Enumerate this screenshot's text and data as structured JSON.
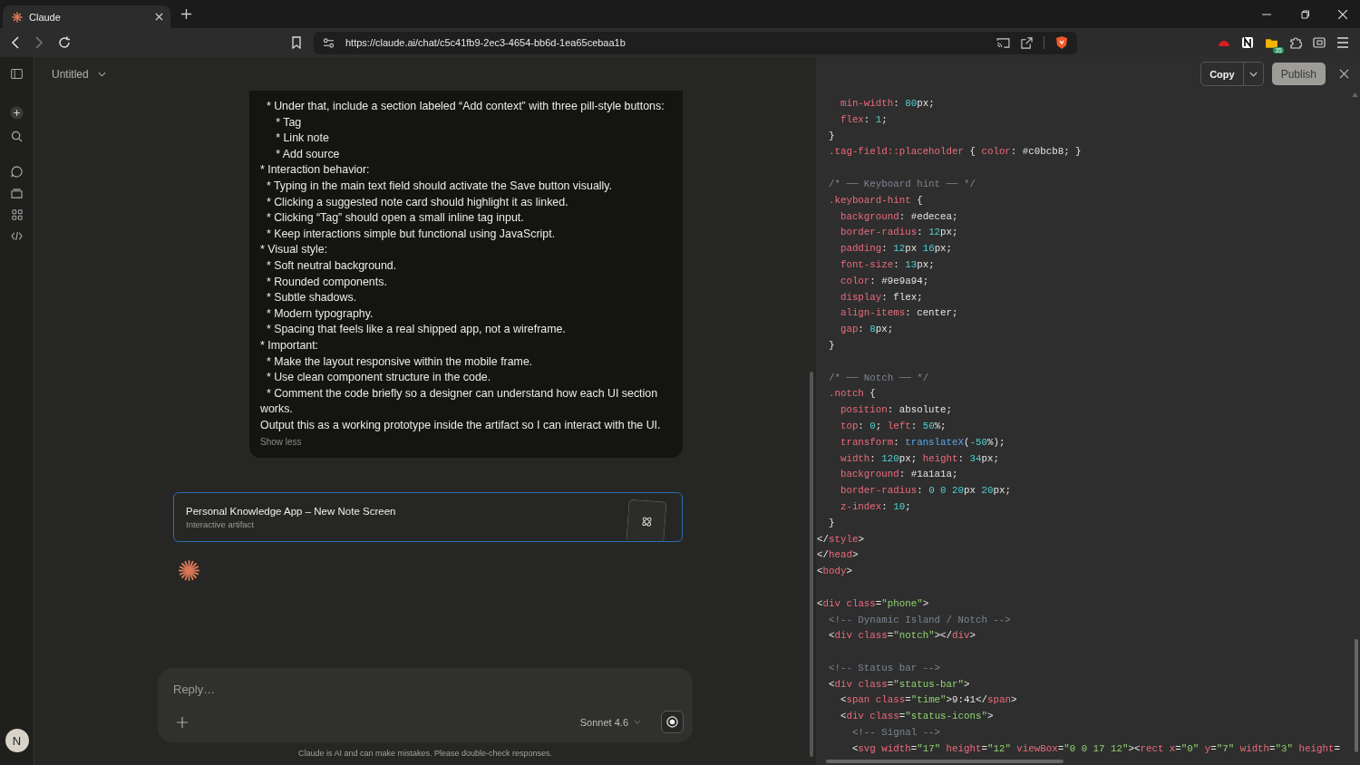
{
  "browser": {
    "tab": {
      "title": "Claude",
      "selected": true
    },
    "url": "https://claude.ai/chat/c5c41fb9-2ec3-4654-bb6d-1ea65cebaa1b",
    "extension_badge": "35"
  },
  "header": {
    "title": "Untitled"
  },
  "prompt": {
    "lines": [
      "  * Under that, include a section labeled “Add context” with three pill-style buttons:",
      "     * Tag",
      "     * Link note",
      "     * Add source",
      "* Interaction behavior:",
      "  * Typing in the main text field should activate the Save button visually.",
      "  * Clicking a suggested note card should highlight it as linked.",
      "  * Clicking “Tag” should open a small inline tag input.",
      "  * Keep interactions simple but functional using JavaScript.",
      "* Visual style:",
      "  * Soft neutral background.",
      "  * Rounded components.",
      "  * Subtle shadows.",
      "  * Modern typography.",
      "  * Spacing that feels like a real shipped app, not a wireframe.",
      "* Important:",
      "  * Make the layout responsive within the mobile frame.",
      "  * Use clean component structure in the code.",
      "  * Comment the code briefly so a designer can understand how each UI section works.",
      "Output this as a working prototype inside the artifact so I can interact with the UI."
    ],
    "toggle": "Show less"
  },
  "artifact": {
    "title": "Personal Knowledge App – New Note Screen",
    "subtitle": "Interactive artifact"
  },
  "composer": {
    "placeholder": "Reply…",
    "model": "Sonnet 4.6"
  },
  "disclaimer": "Claude is AI and can make mistakes. Please double-check responses.",
  "user": {
    "initial": "N"
  },
  "panel": {
    "copy": "Copy",
    "publish": "Publish"
  },
  "code": [
    {
      "kind": "code",
      "tokens": [
        {
          "kind": "property",
          "text": "    min-width"
        },
        {
          "kind": "plain",
          "text": ": "
        },
        {
          "kind": "number",
          "text": "80"
        },
        {
          "kind": "plain",
          "text": "px;"
        }
      ]
    },
    {
      "kind": "code",
      "tokens": [
        {
          "kind": "property",
          "text": "    flex"
        },
        {
          "kind": "plain",
          "text": ": "
        },
        {
          "kind": "number",
          "text": "1"
        },
        {
          "kind": "plain",
          "text": ";"
        }
      ]
    },
    {
      "kind": "code",
      "tokens": [
        {
          "kind": "plain",
          "text": "  }"
        }
      ]
    },
    {
      "kind": "code",
      "tokens": [
        {
          "kind": "selector",
          "text": "  .tag-field::placeholder"
        },
        {
          "kind": "plain",
          "text": " { "
        },
        {
          "kind": "property",
          "text": "color"
        },
        {
          "kind": "plain",
          "text": ": #c0bcb8; }"
        }
      ]
    },
    {
      "kind": "blank"
    },
    {
      "kind": "code",
      "tokens": [
        {
          "kind": "comment",
          "text": "  /* ── Keyboard hint ── */"
        }
      ]
    },
    {
      "kind": "code",
      "tokens": [
        {
          "kind": "selector",
          "text": "  .keyboard-hint"
        },
        {
          "kind": "plain",
          "text": " {"
        }
      ]
    },
    {
      "kind": "code",
      "tokens": [
        {
          "kind": "property",
          "text": "    background"
        },
        {
          "kind": "plain",
          "text": ": #edecea;"
        }
      ]
    },
    {
      "kind": "code",
      "tokens": [
        {
          "kind": "property",
          "text": "    border-radius"
        },
        {
          "kind": "plain",
          "text": ": "
        },
        {
          "kind": "number",
          "text": "12"
        },
        {
          "kind": "plain",
          "text": "px;"
        }
      ]
    },
    {
      "kind": "code",
      "tokens": [
        {
          "kind": "property",
          "text": "    padding"
        },
        {
          "kind": "plain",
          "text": ": "
        },
        {
          "kind": "number",
          "text": "12"
        },
        {
          "kind": "plain",
          "text": "px "
        },
        {
          "kind": "number",
          "text": "16"
        },
        {
          "kind": "plain",
          "text": "px;"
        }
      ]
    },
    {
      "kind": "code",
      "tokens": [
        {
          "kind": "property",
          "text": "    font-size"
        },
        {
          "kind": "plain",
          "text": ": "
        },
        {
          "kind": "number",
          "text": "13"
        },
        {
          "kind": "plain",
          "text": "px;"
        }
      ]
    },
    {
      "kind": "code",
      "tokens": [
        {
          "kind": "property",
          "text": "    color"
        },
        {
          "kind": "plain",
          "text": ": #9e9a94;"
        }
      ]
    },
    {
      "kind": "code",
      "tokens": [
        {
          "kind": "property",
          "text": "    display"
        },
        {
          "kind": "plain",
          "text": ": flex;"
        }
      ]
    },
    {
      "kind": "code",
      "tokens": [
        {
          "kind": "property",
          "text": "    align-items"
        },
        {
          "kind": "plain",
          "text": ": center;"
        }
      ]
    },
    {
      "kind": "code",
      "tokens": [
        {
          "kind": "property",
          "text": "    gap"
        },
        {
          "kind": "plain",
          "text": ": "
        },
        {
          "kind": "number",
          "text": "8"
        },
        {
          "kind": "plain",
          "text": "px;"
        }
      ]
    },
    {
      "kind": "code",
      "tokens": [
        {
          "kind": "plain",
          "text": "  }"
        }
      ]
    },
    {
      "kind": "blank"
    },
    {
      "kind": "code",
      "tokens": [
        {
          "kind": "comment",
          "text": "  /* ── Notch ── */"
        }
      ]
    },
    {
      "kind": "code",
      "tokens": [
        {
          "kind": "selector",
          "text": "  .notch"
        },
        {
          "kind": "plain",
          "text": " {"
        }
      ]
    },
    {
      "kind": "code",
      "tokens": [
        {
          "kind": "property",
          "text": "    position"
        },
        {
          "kind": "plain",
          "text": ": absolute;"
        }
      ]
    },
    {
      "kind": "code",
      "tokens": [
        {
          "kind": "property",
          "text": "    top"
        },
        {
          "kind": "plain",
          "text": ": "
        },
        {
          "kind": "number",
          "text": "0"
        },
        {
          "kind": "plain",
          "text": "; "
        },
        {
          "kind": "property",
          "text": "left"
        },
        {
          "kind": "plain",
          "text": ": "
        },
        {
          "kind": "number",
          "text": "50"
        },
        {
          "kind": "plain",
          "text": "%;"
        }
      ]
    },
    {
      "kind": "code",
      "tokens": [
        {
          "kind": "property",
          "text": "    transform"
        },
        {
          "kind": "plain",
          "text": ": "
        },
        {
          "kind": "function",
          "text": "translateX"
        },
        {
          "kind": "plain",
          "text": "("
        },
        {
          "kind": "number",
          "text": "-50"
        },
        {
          "kind": "plain",
          "text": "%);"
        }
      ]
    },
    {
      "kind": "code",
      "tokens": [
        {
          "kind": "property",
          "text": "    width"
        },
        {
          "kind": "plain",
          "text": ": "
        },
        {
          "kind": "number",
          "text": "120"
        },
        {
          "kind": "plain",
          "text": "px; "
        },
        {
          "kind": "property",
          "text": "height"
        },
        {
          "kind": "plain",
          "text": ": "
        },
        {
          "kind": "number",
          "text": "34"
        },
        {
          "kind": "plain",
          "text": "px;"
        }
      ]
    },
    {
      "kind": "code",
      "tokens": [
        {
          "kind": "property",
          "text": "    background"
        },
        {
          "kind": "plain",
          "text": ": #1a1a1a;"
        }
      ]
    },
    {
      "kind": "code",
      "tokens": [
        {
          "kind": "property",
          "text": "    border-radius"
        },
        {
          "kind": "plain",
          "text": ": "
        },
        {
          "kind": "number",
          "text": "0 0 20"
        },
        {
          "kind": "plain",
          "text": "px "
        },
        {
          "kind": "number",
          "text": "20"
        },
        {
          "kind": "plain",
          "text": "px;"
        }
      ]
    },
    {
      "kind": "code",
      "tokens": [
        {
          "kind": "property",
          "text": "    z-index"
        },
        {
          "kind": "plain",
          "text": ": "
        },
        {
          "kind": "number",
          "text": "10"
        },
        {
          "kind": "plain",
          "text": ";"
        }
      ]
    },
    {
      "kind": "code",
      "tokens": [
        {
          "kind": "plain",
          "text": "  }"
        }
      ]
    },
    {
      "kind": "code",
      "tokens": [
        {
          "kind": "plain",
          "text": "</"
        },
        {
          "kind": "tag",
          "text": "style"
        },
        {
          "kind": "plain",
          "text": ">"
        }
      ]
    },
    {
      "kind": "code",
      "tokens": [
        {
          "kind": "plain",
          "text": "</"
        },
        {
          "kind": "tag",
          "text": "head"
        },
        {
          "kind": "plain",
          "text": ">"
        }
      ]
    },
    {
      "kind": "code",
      "tokens": [
        {
          "kind": "plain",
          "text": "<"
        },
        {
          "kind": "tag",
          "text": "body"
        },
        {
          "kind": "plain",
          "text": ">"
        }
      ]
    },
    {
      "kind": "blank"
    },
    {
      "kind": "code",
      "tokens": [
        {
          "kind": "plain",
          "text": "<"
        },
        {
          "kind": "tag",
          "text": "div"
        },
        {
          "kind": "attr",
          "text": " class"
        },
        {
          "kind": "plain",
          "text": "="
        },
        {
          "kind": "string",
          "text": "\"phone\""
        },
        {
          "kind": "plain",
          "text": ">"
        }
      ]
    },
    {
      "kind": "code",
      "tokens": [
        {
          "kind": "comment",
          "text": "  <!-- Dynamic Island / Notch -->"
        }
      ]
    },
    {
      "kind": "code",
      "tokens": [
        {
          "kind": "plain",
          "text": "  <"
        },
        {
          "kind": "tag",
          "text": "div"
        },
        {
          "kind": "attr",
          "text": " class"
        },
        {
          "kind": "plain",
          "text": "="
        },
        {
          "kind": "string",
          "text": "\"notch\""
        },
        {
          "kind": "plain",
          "text": "></"
        },
        {
          "kind": "tag",
          "text": "div"
        },
        {
          "kind": "plain",
          "text": ">"
        }
      ]
    },
    {
      "kind": "blank"
    },
    {
      "kind": "code",
      "tokens": [
        {
          "kind": "comment",
          "text": "  <!-- Status bar -->"
        }
      ]
    },
    {
      "kind": "code",
      "tokens": [
        {
          "kind": "plain",
          "text": "  <"
        },
        {
          "kind": "tag",
          "text": "div"
        },
        {
          "kind": "attr",
          "text": " class"
        },
        {
          "kind": "plain",
          "text": "="
        },
        {
          "kind": "string",
          "text": "\"status-bar\""
        },
        {
          "kind": "plain",
          "text": ">"
        }
      ]
    },
    {
      "kind": "code",
      "tokens": [
        {
          "kind": "plain",
          "text": "    <"
        },
        {
          "kind": "tag",
          "text": "span"
        },
        {
          "kind": "attr",
          "text": " class"
        },
        {
          "kind": "plain",
          "text": "="
        },
        {
          "kind": "string",
          "text": "\"time\""
        },
        {
          "kind": "plain",
          "text": ">9:41</"
        },
        {
          "kind": "tag",
          "text": "span"
        },
        {
          "kind": "plain",
          "text": ">"
        }
      ]
    },
    {
      "kind": "code",
      "tokens": [
        {
          "kind": "plain",
          "text": "    <"
        },
        {
          "kind": "tag",
          "text": "div"
        },
        {
          "kind": "attr",
          "text": " class"
        },
        {
          "kind": "plain",
          "text": "="
        },
        {
          "kind": "string",
          "text": "\"status-icons\""
        },
        {
          "kind": "plain",
          "text": ">"
        }
      ]
    },
    {
      "kind": "code",
      "tokens": [
        {
          "kind": "comment",
          "text": "      <!-- Signal -->"
        }
      ]
    },
    {
      "kind": "code",
      "tokens": [
        {
          "kind": "plain",
          "text": "      <"
        },
        {
          "kind": "tag",
          "text": "svg"
        },
        {
          "kind": "attr",
          "text": " width"
        },
        {
          "kind": "plain",
          "text": "="
        },
        {
          "kind": "string",
          "text": "\"17\""
        },
        {
          "kind": "attr",
          "text": " height"
        },
        {
          "kind": "plain",
          "text": "="
        },
        {
          "kind": "string",
          "text": "\"12\""
        },
        {
          "kind": "attr",
          "text": " viewBox"
        },
        {
          "kind": "plain",
          "text": "="
        },
        {
          "kind": "string",
          "text": "\"0 0 17 12\""
        },
        {
          "kind": "plain",
          "text": "><"
        },
        {
          "kind": "tag",
          "text": "rect"
        },
        {
          "kind": "attr",
          "text": " x"
        },
        {
          "kind": "plain",
          "text": "="
        },
        {
          "kind": "string",
          "text": "\"0\""
        },
        {
          "kind": "attr",
          "text": " y"
        },
        {
          "kind": "plain",
          "text": "="
        },
        {
          "kind": "string",
          "text": "\"7\""
        },
        {
          "kind": "attr",
          "text": " width"
        },
        {
          "kind": "plain",
          "text": "="
        },
        {
          "kind": "string",
          "text": "\"3\""
        },
        {
          "kind": "attr",
          "text": " height"
        },
        {
          "kind": "plain",
          "text": "="
        }
      ]
    }
  ]
}
